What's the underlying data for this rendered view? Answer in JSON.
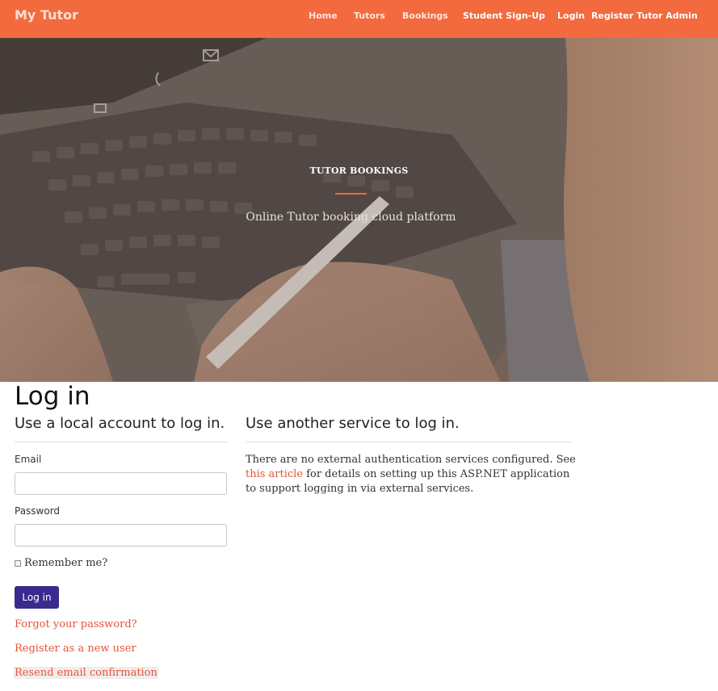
{
  "colors": {
    "navbar_bg": "#f26a3d",
    "accent": "#f26a3d",
    "link": "#e5543a",
    "button_bg": "#3a2a8e"
  },
  "navbar": {
    "brand": "My Tutor",
    "links": {
      "home": "Home",
      "tutors": "Tutors",
      "bookings": "Bookings",
      "student_signup": "Student Sign-Up",
      "login": "Login",
      "register_tutor_admin": "Register Tutor Admin"
    }
  },
  "hero": {
    "title": "TUTOR BOOKINGS",
    "subtitle": "Online Tutor booking cloud platform"
  },
  "login": {
    "page_title": "Log in",
    "local_heading": "Use a local account to log in.",
    "email_label": "Email",
    "email_value": "",
    "password_label": "Password",
    "password_value": "",
    "remember_label": "Remember me?",
    "submit_label": "Log in",
    "forgot_link": "Forgot your password?",
    "register_link": "Register as a new user",
    "resend_link": "Resend email confirmation"
  },
  "external": {
    "heading": "Use another service to log in.",
    "text_before": "There are no external authentication services configured. See",
    "link_text": "this article",
    "text_after": "for details on setting up this ASP.NET application to support logging in via external services."
  }
}
